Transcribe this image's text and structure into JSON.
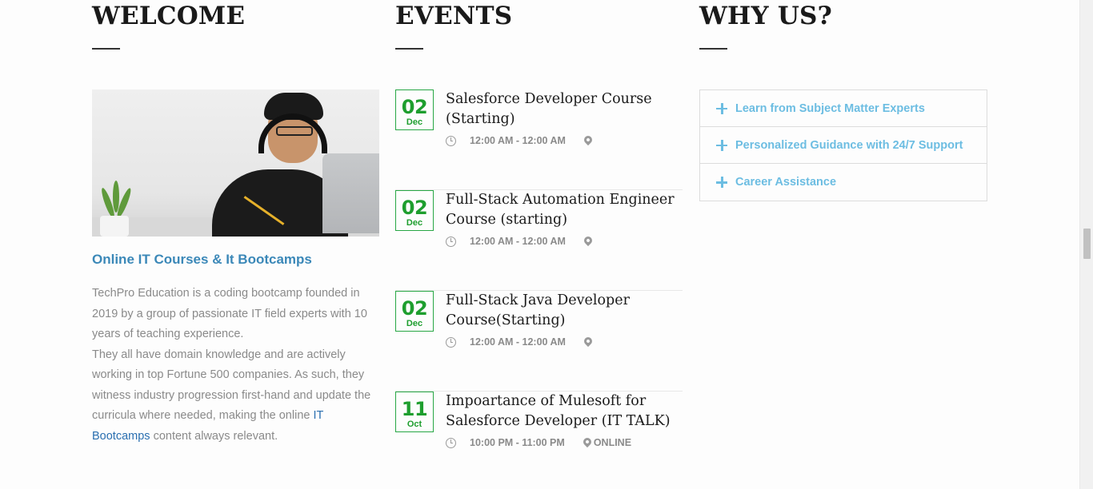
{
  "welcome": {
    "heading": "WELCOME",
    "subtitle": "Online IT Courses & It Bootcamps",
    "paragraph1": "TechPro Education is a coding bootcamp founded in 2019 by a group of passionate IT field experts with 10 years of teaching experience.",
    "paragraph2_before": "They all have domain knowledge and are actively working in top Fortune 500 companies. As such, they witness industry progression first-hand and update the curricula where needed, making the online ",
    "paragraph2_link": "IT Bootcamps",
    "paragraph2_after": " content always relevant."
  },
  "events": {
    "heading": "EVENTS",
    "items": [
      {
        "day": "02",
        "month": "Dec",
        "title": "Salesforce Developer Course (Starting)",
        "time": "12:00 AM - 12:00 AM",
        "location": ""
      },
      {
        "day": "02",
        "month": "Dec",
        "title": "Full-Stack Automation Engineer Course (starting)",
        "time": "12:00 AM - 12:00 AM",
        "location": ""
      },
      {
        "day": "02",
        "month": "Dec",
        "title": "Full-Stack Java Developer Course(Starting)",
        "time": "12:00 AM - 12:00 AM",
        "location": ""
      },
      {
        "day": "11",
        "month": "Oct",
        "title": "Impoartance of Mulesoft for Salesforce Developer (IT TALK)",
        "time": "10:00 PM - 11:00 PM",
        "location": "ONLINE"
      }
    ]
  },
  "why": {
    "heading": "WHY US?",
    "items": [
      "Learn from Subject Matter Experts",
      "Personalized Guidance with 24/7 Support",
      "Career Assistance"
    ]
  },
  "colors": {
    "accent_blue": "#3b88b8",
    "accordion_blue": "#6cbde2",
    "date_green": "#1e9e2e"
  }
}
